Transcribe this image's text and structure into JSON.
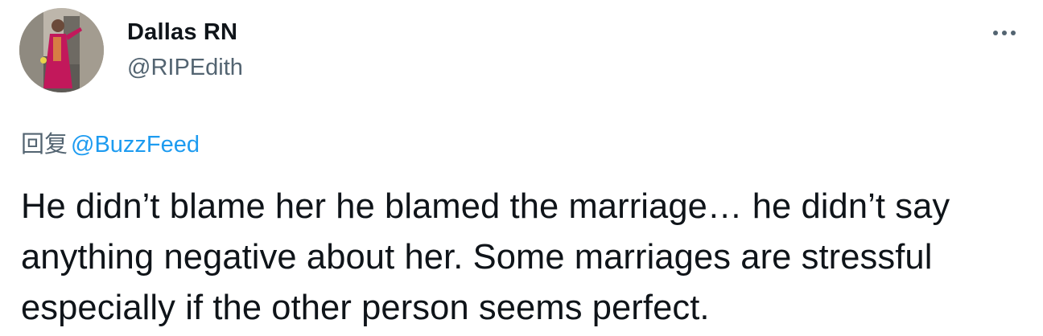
{
  "author": {
    "name": "Dallas RN",
    "handle": "@RIPEdith"
  },
  "reply": {
    "prefix": "回复",
    "mention": "@BuzzFeed"
  },
  "tweet": {
    "text": "He didn’t blame her he blamed the marriage… he didn’t say anything negative about her. Some marriages are stressful especially if the other person seems perfect."
  },
  "icons": {
    "more": "more-horizontal-icon"
  },
  "colors": {
    "text_primary": "#0f1419",
    "text_secondary": "#536471",
    "link": "#1d9bf0"
  }
}
